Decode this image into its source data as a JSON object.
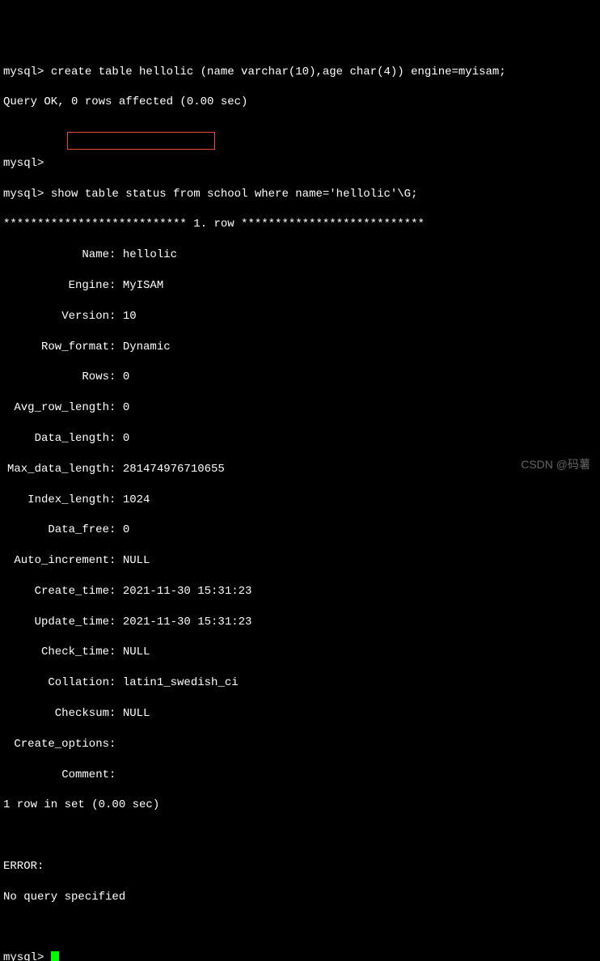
{
  "lines": {
    "cmd1_prompt": "mysql> ",
    "cmd1": "create table hellolic (name varchar(10),age char(4)) engine=myisam;",
    "result1": "Query OK, 0 rows affected (0.00 sec)",
    "empty_prompt": "mysql>",
    "cmd2_prompt": "mysql> ",
    "cmd2": "show table status from school where name='hellolic'\\G;",
    "row_header": "*************************** 1. row ***************************",
    "fields": [
      {
        "label": "Name",
        "value": "hellolic"
      },
      {
        "label": "Engine",
        "value": "MyISAM"
      },
      {
        "label": "Version",
        "value": "10"
      },
      {
        "label": "Row_format",
        "value": "Dynamic"
      },
      {
        "label": "Rows",
        "value": "0"
      },
      {
        "label": "Avg_row_length",
        "value": "0"
      },
      {
        "label": "Data_length",
        "value": "0"
      },
      {
        "label": "Max_data_length",
        "value": "281474976710655"
      },
      {
        "label": "Index_length",
        "value": "1024"
      },
      {
        "label": "Data_free",
        "value": "0"
      },
      {
        "label": "Auto_increment",
        "value": "NULL"
      },
      {
        "label": "Create_time",
        "value": "2021-11-30 15:31:23"
      },
      {
        "label": "Update_time",
        "value": "2021-11-30 15:31:23"
      },
      {
        "label": "Check_time",
        "value": "NULL"
      },
      {
        "label": "Collation",
        "value": "latin1_swedish_ci"
      },
      {
        "label": "Checksum",
        "value": "NULL"
      },
      {
        "label": "Create_options",
        "value": ""
      },
      {
        "label": "Comment",
        "value": ""
      }
    ],
    "result2": "1 row in set (0.00 sec)",
    "error_label": "ERROR:",
    "error_msg": "No query specified",
    "final_prompt": "mysql> "
  },
  "watermark": "CSDN @码薯"
}
